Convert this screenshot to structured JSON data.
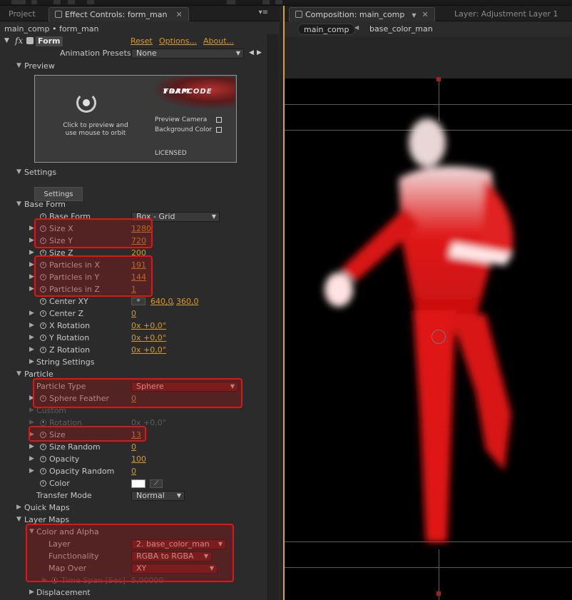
{
  "left_panel": {
    "tabs": {
      "project": "Project",
      "effect_controls": "Effect Controls: form_man"
    },
    "breadcrumb": "main_comp • form_man",
    "effect": {
      "fx_icon": "fx",
      "name": "Form",
      "reset": "Reset",
      "options": "Options...",
      "about": "About..."
    },
    "animation_presets": {
      "label": "Animation Presets:",
      "value": "None"
    },
    "preview": {
      "section": "Preview",
      "hint": "Click to preview and use mouse to orbit",
      "logo_line1": "TRAPCODE",
      "logo_line2": "FORM",
      "preview_camera": "Preview Camera",
      "background_color": "Background Color",
      "licensed": "LICENSED"
    },
    "settings": {
      "section": "Settings",
      "button": "Settings"
    },
    "base_form": {
      "section": "Base Form",
      "base_form_label": "Base Form",
      "base_form_value": "Box - Grid",
      "size_x_label": "Size X",
      "size_x": "1280",
      "size_y_label": "Size Y",
      "size_y": "720",
      "size_z_label": "Size Z",
      "size_z": "200",
      "particles_x_label": "Particles in X",
      "particles_x": "191",
      "particles_y_label": "Particles in Y",
      "particles_y": "144",
      "particles_z_label": "Particles in Z",
      "particles_z": "1",
      "center_xy_label": "Center XY",
      "center_xy_x": "640,0",
      "center_xy_y": "360,0",
      "center_z_label": "Center Z",
      "center_z": "0",
      "x_rot_label": "X Rotation",
      "x_rot": "0x +0,0°",
      "y_rot_label": "Y Rotation",
      "y_rot": "0x +0,0°",
      "z_rot_label": "Z Rotation",
      "z_rot": "0x +0,0°",
      "string_settings": "String Settings"
    },
    "particle": {
      "section": "Particle",
      "type_label": "Particle Type",
      "type_value": "Sphere",
      "feather_label": "Sphere Feather",
      "feather": "0",
      "custom": "Custom",
      "rotation_label": "Rotation",
      "rotation": "0x +0,0°",
      "size_label": "Size",
      "size": "13",
      "size_random_label": "Size Random",
      "size_random": "0",
      "opacity_label": "Opacity",
      "opacity": "100",
      "opacity_random_label": "Opacity Random",
      "opacity_random": "0",
      "color_label": "Color",
      "transfer_label": "Transfer Mode",
      "transfer_value": "Normal"
    },
    "quick_maps": "Quick Maps",
    "layer_maps": {
      "section": "Layer Maps",
      "color_alpha": "Color and Alpha",
      "layer_label": "Layer",
      "layer_value": "2. base_color_man",
      "functionality_label": "Functionality",
      "functionality_value": "RGBA to RGBA",
      "map_over_label": "Map Over",
      "map_over_value": "XY",
      "time_span_label": "Time Span [Sec]",
      "time_span": "5,00000",
      "displacement": "Displacement"
    }
  },
  "right_panel": {
    "tabs": {
      "composition": "Composition: main_comp",
      "layer": "Layer: Adjustment Layer 1"
    },
    "breadcrumb": {
      "comp": "main_comp",
      "layer": "base_color_man"
    }
  },
  "colors": {
    "accent_value": "#d99a26",
    "highlight": "#e51414",
    "panel_bg": "#2b2b2b",
    "viewer_bg": "#000000",
    "active_panel_border": "#d6a42a"
  },
  "icons": [
    "tab-icon",
    "close-icon",
    "panel-menu-icon",
    "twirl-icon",
    "stopwatch-icon",
    "effect-cube-icon",
    "orbit-icon",
    "position-crosshair-icon",
    "eyedropper-icon",
    "color-swatch-icon",
    "chevron-down-icon"
  ]
}
